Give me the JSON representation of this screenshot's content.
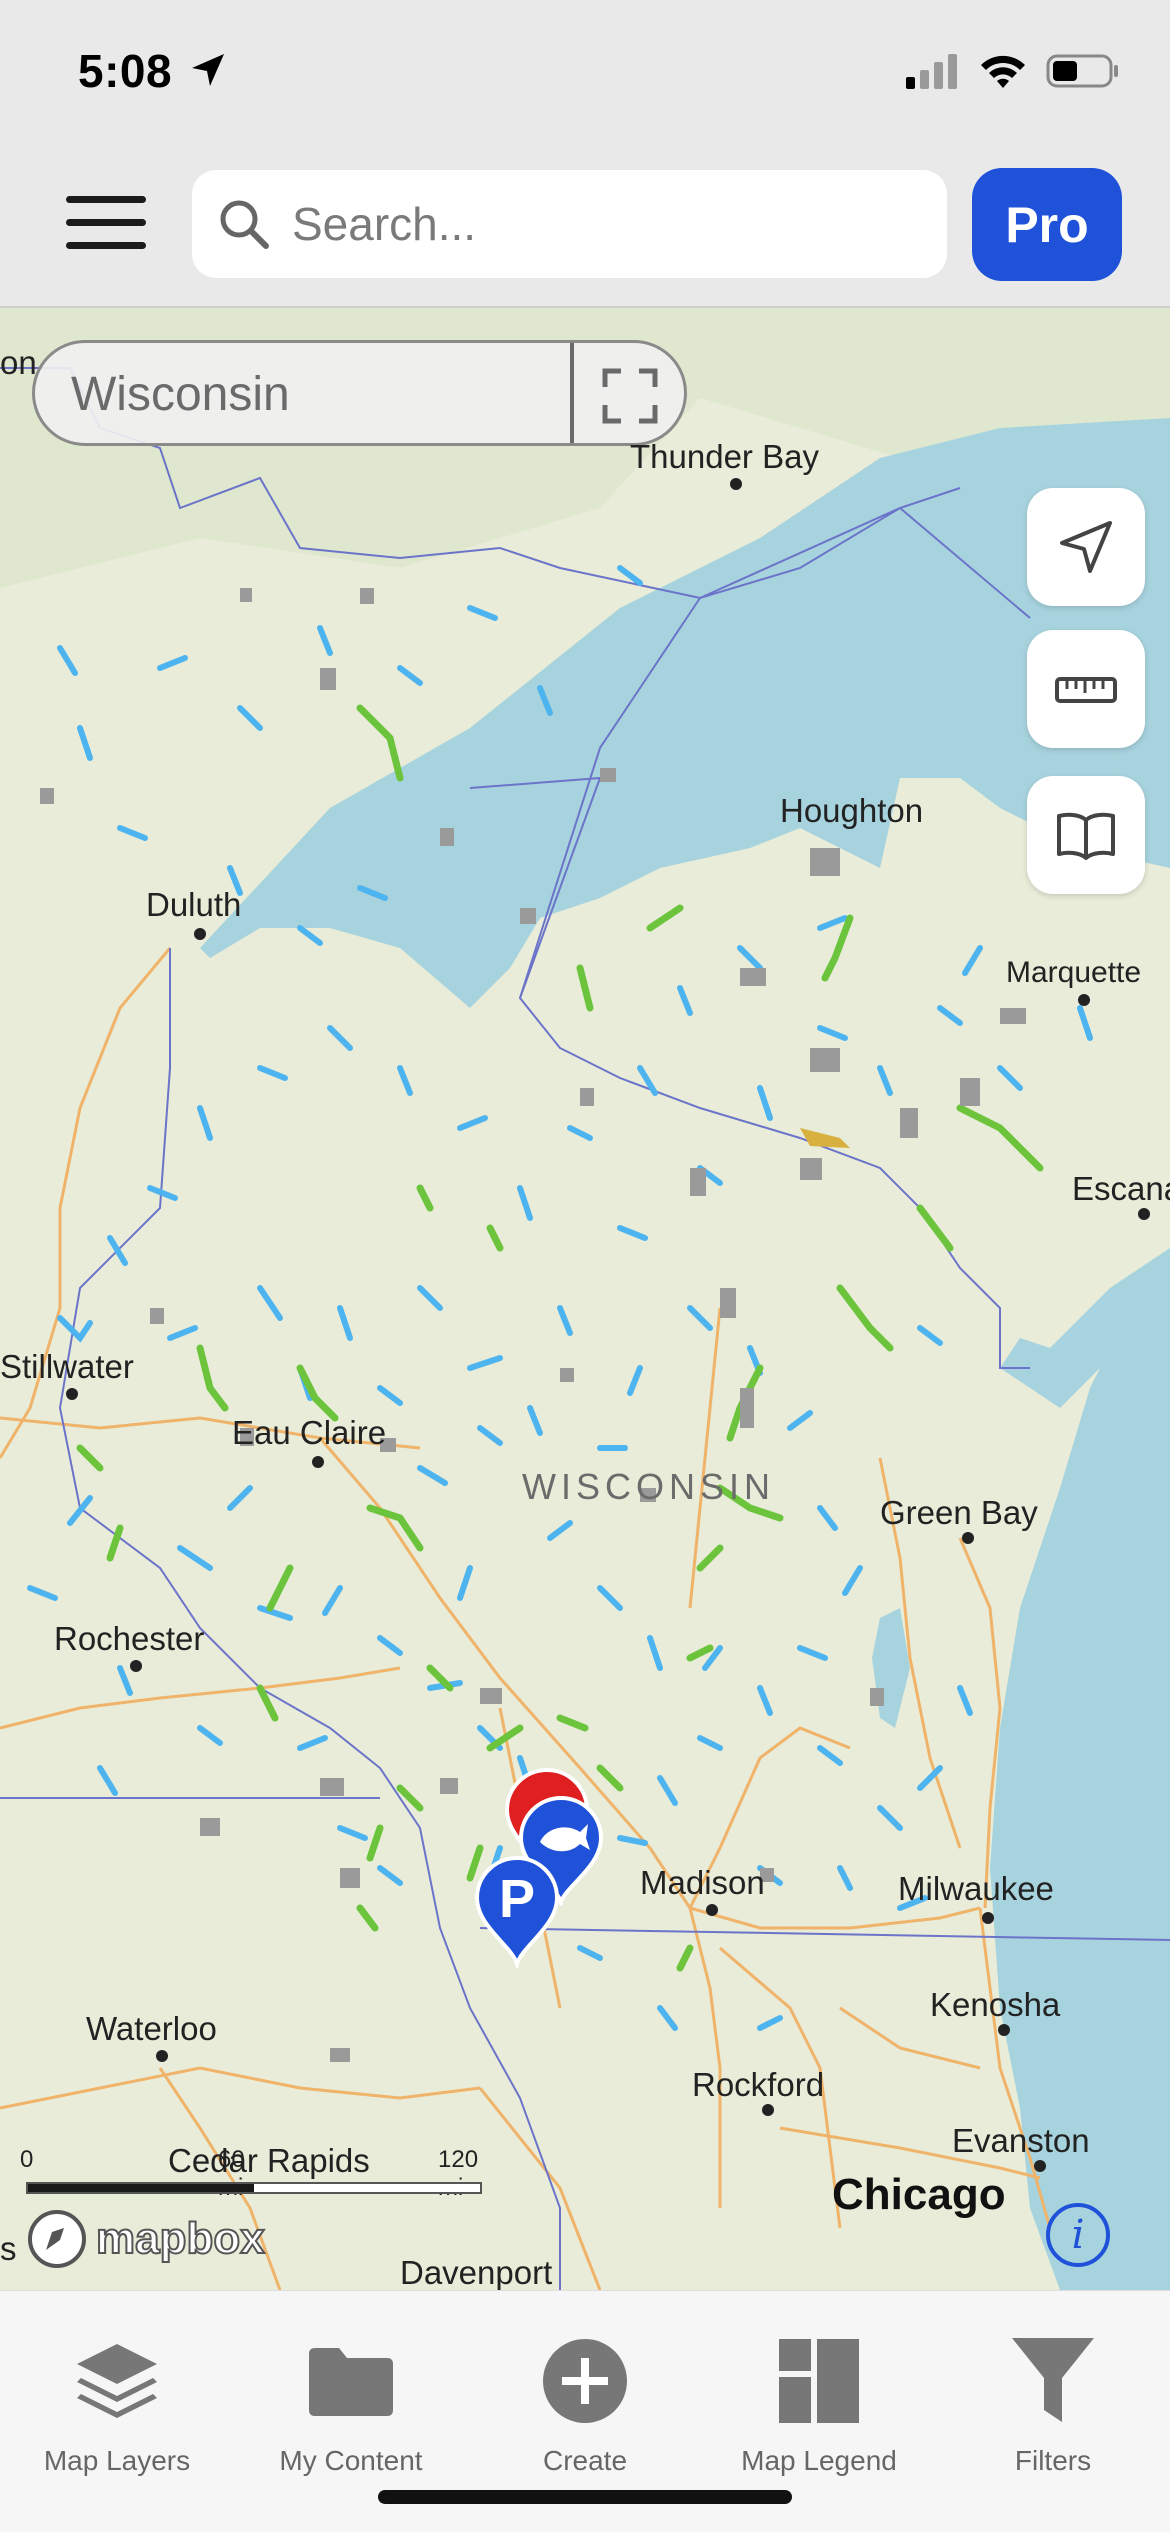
{
  "status_bar": {
    "time": "5:08"
  },
  "top_bar": {
    "search_placeholder": "Search...",
    "pro_label": "Pro"
  },
  "map": {
    "region": "Wisconsin",
    "state_label": "WISCONSIN",
    "cities": {
      "thunder_bay": "Thunder Bay",
      "houghton": "Houghton",
      "marquette": "Marquette",
      "duluth": "Duluth",
      "escanaba": "Escana",
      "stillwater": "Stillwater",
      "eau_claire": "Eau Claire",
      "green_bay": "Green Bay",
      "rochester": "Rochester",
      "madison": "Madison",
      "milwaukee": "Milwaukee",
      "waterloo": "Waterloo",
      "kenosha": "Kenosha",
      "rockford": "Rockford",
      "evanston": "Evanston",
      "cedar_rapids": "Cedar Rapids",
      "chicago": "Chicago",
      "davenport": "Davenport",
      "on_edge": "on",
      "s_edge": "s"
    },
    "scale": {
      "zero": "0",
      "mid": "60 mi",
      "max": "120 mi"
    },
    "attribution": "mapbox",
    "info_label": "i",
    "pin_parking_label": "P"
  },
  "bottom_nav": [
    {
      "label": "Map Layers",
      "icon": "layers-icon"
    },
    {
      "label": "My Content",
      "icon": "folder-icon"
    },
    {
      "label": "Create",
      "icon": "plus-circle-icon"
    },
    {
      "label": "Map Legend",
      "icon": "legend-icon"
    },
    {
      "label": "Filters",
      "icon": "filter-icon"
    }
  ],
  "colors": {
    "accent": "#1f52d9",
    "water": "#a7d3de",
    "land": "#e8ecd8",
    "stream": "#4eb4f0",
    "trout_stream": "#6cc43c",
    "public_land": "#9a9a9a",
    "pin_red": "#e02020"
  }
}
